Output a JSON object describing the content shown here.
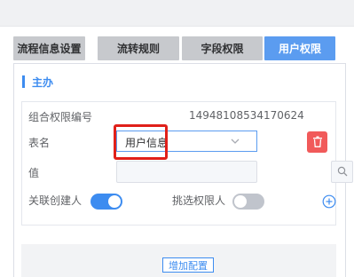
{
  "tabs": [
    {
      "label": "流程信息设置",
      "active": false
    },
    {
      "label": "流转规则",
      "active": false
    },
    {
      "label": "字段权限",
      "active": false
    },
    {
      "label": "用户权限",
      "active": true
    }
  ],
  "section": {
    "title": "主办"
  },
  "form": {
    "group_id_label": "组合权限编号",
    "group_id_value": "14948108534170624",
    "table_label": "表名",
    "table_value": "用户信息",
    "value_label": "值",
    "value_input": "",
    "link_creator_label": "关联创建人",
    "link_creator_on": true,
    "pick_permission_label": "挑选权限人",
    "pick_permission_on": false
  },
  "actions": {
    "add_config_label": "增加配置"
  },
  "icons": [
    "chevron-down-icon",
    "trash-icon",
    "search-icon",
    "plus-circle-icon"
  ],
  "colors": {
    "accent": "#3d8cf0",
    "danger": "#f15a5a",
    "highlight": "#e0201a",
    "tab_inactive": "#c7c9cd"
  }
}
